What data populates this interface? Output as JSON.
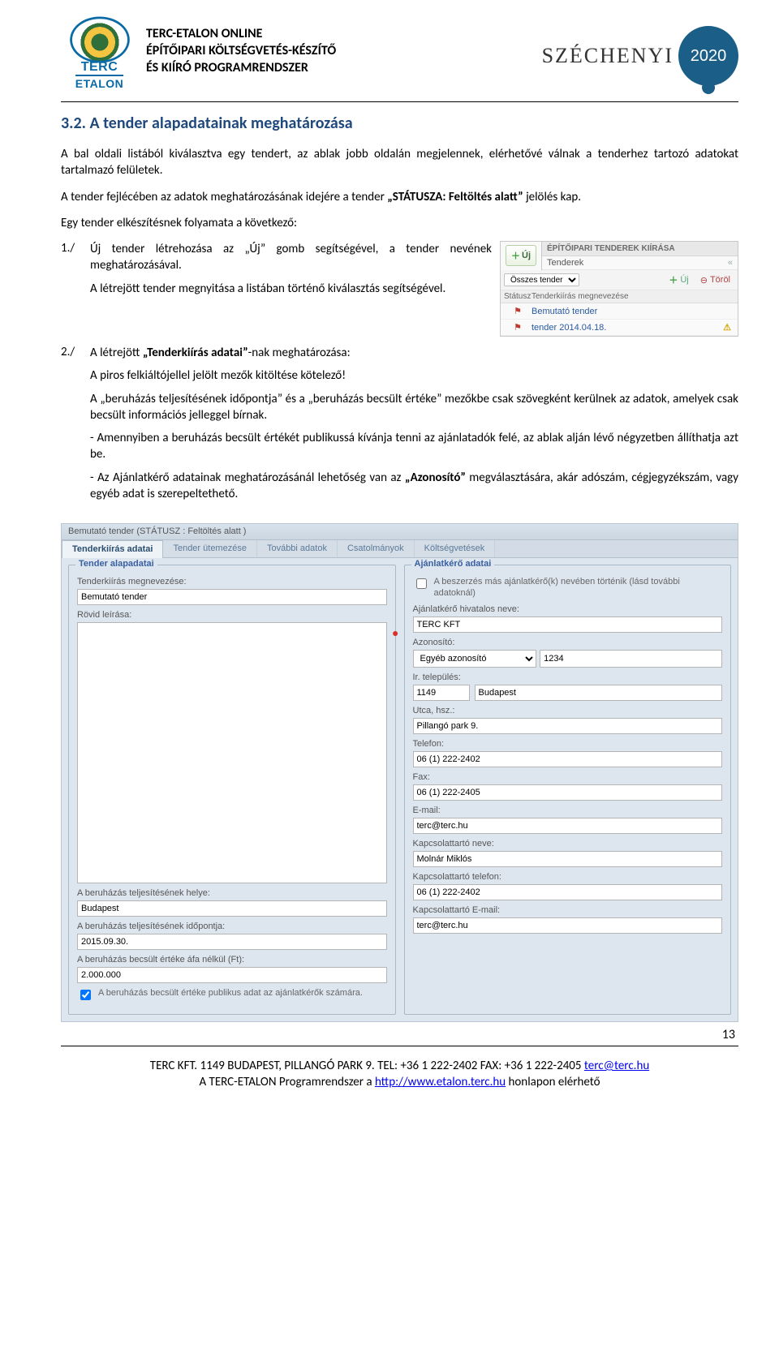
{
  "header": {
    "logo_line1": "TERC",
    "logo_line2": "ETALON",
    "title_l1": "TERC-ETALON ONLINE",
    "title_l2": "ÉPÍTŐIPARI KÖLTSÉGVETÉS-KÉSZÍTŐ",
    "title_l3": "ÉS KIÍRÓ PROGRAMRENDSZER",
    "szechenyi": "SZÉCHENYI",
    "szechenyi_year": "2020"
  },
  "section_title": "3.2. A tender alapadatainak meghatározása",
  "para1": "A bal oldali listából kiválasztva egy tendert, az ablak jobb oldalán megjelennek, elérhetővé válnak a tenderhez tartozó adatokat tartalmazó felületek.",
  "para2_pre": "A tender fejlécében az adatok meghatározásának idejére a tender ",
  "para2_quote": "„STÁTUSZA: Feltöltés alatt”",
  "para2_post": " jelölés kap.",
  "para3": "Egy tender elkészítésnek folyamata a következő:",
  "list": {
    "n1_num": "1./",
    "n1_a": "Új tender létrehozása az „Új” gomb segítségével, a tender nevének meghatározásával.",
    "n1_b": "A létrejött tender megnyitása a listában történő kiválasztás segítségével.",
    "n2_num": "2./",
    "n2_a_pre": "A létrejött ",
    "n2_a_bold": "„Tenderkiírás adatai”",
    "n2_a_post": "-nak meghatározása:",
    "n2_b": "A piros felkiáltójellel jelölt mezők kitöltése kötelező!",
    "n2_c": "A „beruházás teljesítésének időpontja” és a „beruházás becsült értéke” mezőkbe csak szövegként kerülnek az adatok, amelyek csak becsült információs jelleggel bírnak.",
    "n2_d": "- Amennyiben a beruházás becsült értékét publikussá kívánja tenni az ajánlatadók felé, az ablak alján lévő négyzetben állíthatja azt be.",
    "n2_e_pre": "- Az Ajánlatkérő adatainak meghatározásánál lehetőség van az ",
    "n2_e_bold": "„Azonosító”",
    "n2_e_post": " megválasztására, akár adószám, cégjegyzékszám, vagy egyéb adat is szerepeltethető."
  },
  "mini": {
    "uj_btn": "Új",
    "title": "ÉPÍTŐIPARI TENDEREK KIÍRÁSA",
    "sub": "Tenderek",
    "chev": "«",
    "search_sel": "Összes tender",
    "btn_uj": "Új",
    "btn_del": "Töröl",
    "col1": "Státusz",
    "col2": "Tenderkiírás megnevezése",
    "row1": "Bemutató tender",
    "row2": "tender 2014.04.18."
  },
  "app": {
    "titlebar": "Bemutató tender (STÁTUSZ : Feltöltés alatt )",
    "tabs": [
      "Tenderkiírás adatai",
      "Tender ütemezése",
      "További adatok",
      "Csatolmányok",
      "Költségvetések"
    ],
    "left_legend": "Tender alapadatai",
    "right_legend": "Ajánlatkérő adatai",
    "left": {
      "lbl_name": "Tenderkiírás megnevezése:",
      "val_name": "Bemutató tender",
      "lbl_desc": "Rövid leírása:",
      "lbl_place": "A beruházás teljesítésének helye:",
      "val_place": "Budapest",
      "lbl_date": "A beruházás teljesítésének időpontja:",
      "val_date": "2015.09.30.",
      "lbl_value": "A beruházás becsült értéke áfa nélkül (Ft):",
      "val_value": "2.000.000",
      "chk_pub": "A beruházás becsült értéke publikus adat az ajánlatkérők számára."
    },
    "right": {
      "chk_other": "A beszerzés más ajánlatkérő(k) nevében történik (lásd további adatoknál)",
      "lbl_official": "Ajánlatkérő hivatalos neve:",
      "val_official": "TERC KFT",
      "lbl_id": "Azonosító:",
      "sel_id": "Egyéb azonosító",
      "val_id": "1234",
      "lbl_town": "Ir. település:",
      "val_zip": "1149",
      "val_city": "Budapest",
      "lbl_street": "Utca, hsz.:",
      "val_street": "Pillangó park 9.",
      "lbl_tel": "Telefon:",
      "val_tel": "06 (1) 222-2402",
      "lbl_fax": "Fax:",
      "val_fax": "06 (1) 222-2405",
      "lbl_email": "E-mail:",
      "val_email": "terc@terc.hu",
      "lbl_contact": "Kapcsolattartó neve:",
      "val_contact": "Molnár Miklós",
      "lbl_ctel": "Kapcsolattartó telefon:",
      "val_ctel": "06 (1) 222-2402",
      "lbl_cemail": "Kapcsolattartó E-mail:",
      "val_cemail": "terc@terc.hu"
    }
  },
  "pagenum": "13",
  "footer": {
    "line1_pre": "TERC KFT. 1149 BUDAPEST, PILLANGÓ PARK 9. TEL: +36 1 222-2402 FAX: +36 1 222-2405 ",
    "line1_link": "terc@terc.hu",
    "line2_pre": "A TERC-ETALON Programrendszer a ",
    "line2_link": "http://www.etalon.terc.hu",
    "line2_post": " honlapon elérhető"
  }
}
